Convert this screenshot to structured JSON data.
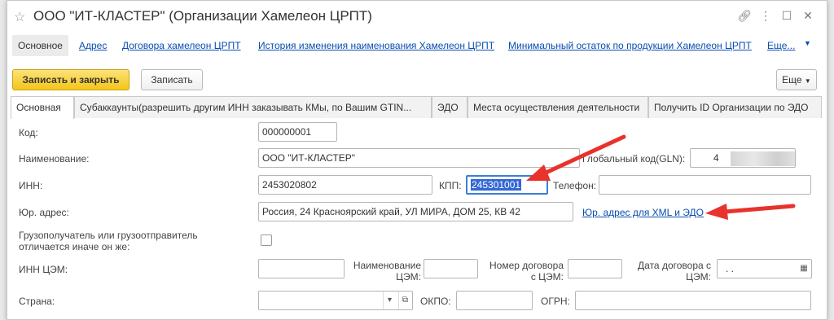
{
  "window": {
    "title": "ООО \"ИТ-КЛАСТЕР\" (Организации Хамелеон ЦРПТ)"
  },
  "nav": {
    "active": "Основное",
    "links": [
      "Адрес",
      "Договора хамелеон ЦРПТ",
      "История изменения наименования Хамелеон ЦРПТ",
      "Минимальный остаток по продукции Хамелеон ЦРПТ",
      "Еще..."
    ]
  },
  "toolbar": {
    "save_close": "Записать и закрыть",
    "save": "Записать",
    "more": "Еще"
  },
  "tabs": [
    "Основная",
    "Субаккаунты(разрешить другим ИНН заказывать КМы, по Вашим GTIN...",
    "ЭДО",
    "Места осуществления деятельности",
    "Получить ID Организации по ЭДО"
  ],
  "form": {
    "code_label": "Код:",
    "code_value": "000000001",
    "name_label": "Наименование:",
    "name_value": "ООО \"ИТ-КЛАСТЕР\"",
    "gln_label": "Глобальный код(GLN):",
    "gln_value": "4",
    "inn_label": "ИНН:",
    "inn_value": "2453020802",
    "kpp_label": "КПП:",
    "kpp_value": "245301001",
    "phone_label": "Телефон:",
    "phone_value": "",
    "address_label": "Юр. адрес:",
    "address_value": "Россия, 24 Красноярский край, УЛ МИРА, ДОМ 25, КВ 42",
    "address_link": "Юр. адрес для XML и ЭДО",
    "consignee_label": "Грузополучатель или грузоотправитель отличается иначе он же:",
    "consignee_checked": false,
    "inn_cem_label": "ИНН ЦЭМ:",
    "name_cem_label": "Наименование ЦЭМ:",
    "contract_num_label": "Номер договора с ЦЭМ:",
    "contract_date_label": "Дата договора с ЦЭМ:",
    "contract_date_value": ". .",
    "country_label": "Страна:",
    "okpo_label": "ОКПО:",
    "ogrn_label": "ОГРН:"
  },
  "colors": {
    "primary_button": "#f5c517",
    "link": "#0a4db0",
    "annotation_arrow": "#e8322b",
    "selection": "#3367d6"
  }
}
